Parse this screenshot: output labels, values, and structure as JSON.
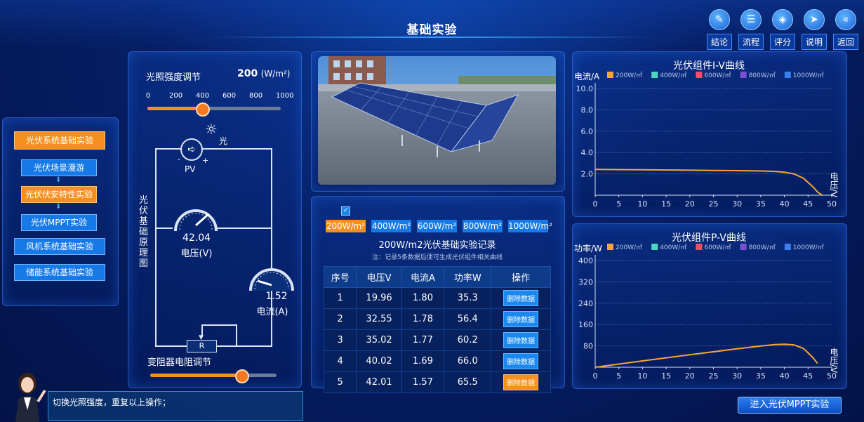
{
  "header": {
    "title": "基础实验",
    "buttons": [
      {
        "label": "结论",
        "icon": "conclusion-icon"
      },
      {
        "label": "流程",
        "icon": "process-icon"
      },
      {
        "label": "评分",
        "icon": "score-icon"
      },
      {
        "label": "说明",
        "icon": "help-icon"
      },
      {
        "label": "返回",
        "icon": "back-icon"
      }
    ]
  },
  "nav": {
    "items": [
      {
        "label": "光伏系统基础实验",
        "active": true
      },
      {
        "label": "光伏场景漫游",
        "active": false
      },
      {
        "label": "光伏伏安特性实验",
        "active": true
      },
      {
        "label": "光伏MPPT实验",
        "active": false
      },
      {
        "label": "风机系统基础实验",
        "active": false
      },
      {
        "label": "储能系统基础实验",
        "active": false
      }
    ]
  },
  "light": {
    "label": "光照强度调节",
    "value": "200",
    "unit": "(W/m²)",
    "ticks": [
      "0",
      "200",
      "400",
      "600",
      "800",
      "1000"
    ],
    "fraction": 0.2
  },
  "circuit": {
    "vertical_label": "光伏基础原理图",
    "pv_label": "PV",
    "light_label": "光",
    "minus": "-",
    "plus": "+",
    "voltage_value": "42.04",
    "voltage_label": "电压(V)",
    "current_value": "1.52",
    "current_label": "电流(A)",
    "resistor_label": "R",
    "rheostat_label": "变阻器电阻调节",
    "rheostat_fraction": 0.72
  },
  "records": {
    "checkbox_checked": true,
    "tabs": [
      "200W/m²",
      "400W/m²",
      "600W/m²",
      "800W/m²",
      "1000W/m²"
    ],
    "active_tab": 0,
    "title": "200W/m2光伏基础实验记录",
    "note": "注：记录5条数据后便可生成光伏组件相关曲线",
    "columns": [
      "序号",
      "电压V",
      "电流A",
      "功率W",
      "操作"
    ],
    "rows": [
      {
        "n": "1",
        "v": "19.96",
        "i": "1.80",
        "p": "35.3",
        "action": "删除数据"
      },
      {
        "n": "2",
        "v": "32.55",
        "i": "1.78",
        "p": "56.4",
        "action": "删除数据"
      },
      {
        "n": "3",
        "v": "35.02",
        "i": "1.77",
        "p": "60.2",
        "action": "删除数据"
      },
      {
        "n": "4",
        "v": "40.02",
        "i": "1.69",
        "p": "66.0",
        "action": "删除数据"
      },
      {
        "n": "5",
        "v": "42.01",
        "i": "1.57",
        "p": "65.5",
        "action": "删除数据"
      }
    ]
  },
  "legend": [
    {
      "name": "200W/㎡",
      "color": "#f5a53a"
    },
    {
      "name": "400W/㎡",
      "color": "#4fd6c0"
    },
    {
      "name": "600W/㎡",
      "color": "#ef4f6a"
    },
    {
      "name": "800W/㎡",
      "color": "#7a4fd0"
    },
    {
      "name": "1000W/㎡",
      "color": "#3b7ef0"
    }
  ],
  "chart_data": [
    {
      "type": "line",
      "title": "光伏组件I-V曲线",
      "ylabel": "电流/A",
      "xlabel": "电压/V",
      "xticks": [
        "0",
        "5",
        "10",
        "15",
        "20",
        "25",
        "30",
        "35",
        "40",
        "45",
        "50"
      ],
      "yticks": [
        "2.0",
        "4.0",
        "6.0",
        "8.0",
        "10.0"
      ],
      "xlim": [
        0,
        50
      ],
      "ylim": [
        0,
        10
      ],
      "grid": true,
      "legend_position": "top",
      "series": [
        {
          "name": "200W/㎡",
          "color": "#f5a53a",
          "x": [
            0,
            10,
            20,
            30,
            35,
            38,
            40,
            42,
            44,
            45,
            46,
            47,
            48
          ],
          "y": [
            2.42,
            2.38,
            2.34,
            2.3,
            2.27,
            2.23,
            2.16,
            2.0,
            1.6,
            1.2,
            0.8,
            0.3,
            0
          ]
        }
      ]
    },
    {
      "type": "line",
      "title": "光伏组件P-V曲线",
      "ylabel": "功率/W",
      "xlabel": "电压/V",
      "xticks": [
        "0",
        "5",
        "10",
        "15",
        "20",
        "25",
        "30",
        "35",
        "40",
        "45",
        "50"
      ],
      "yticks": [
        "80",
        "160",
        "240",
        "320",
        "400"
      ],
      "xlim": [
        0,
        50
      ],
      "ylim": [
        0,
        400
      ],
      "grid": true,
      "legend_position": "top",
      "series": [
        {
          "name": "200W/㎡",
          "color": "#f5a53a",
          "x": [
            0,
            10,
            20,
            30,
            35,
            38,
            40,
            42,
            44,
            45,
            46,
            47
          ],
          "y": [
            0,
            23.8,
            46.8,
            69.0,
            79.5,
            84.7,
            86.4,
            84.0,
            70.4,
            54.0,
            36.8,
            14.1
          ]
        }
      ]
    }
  ],
  "assistant_message": "切换光照强度，重复以上操作；",
  "mppt_button": "进入光伏MPPT实验"
}
